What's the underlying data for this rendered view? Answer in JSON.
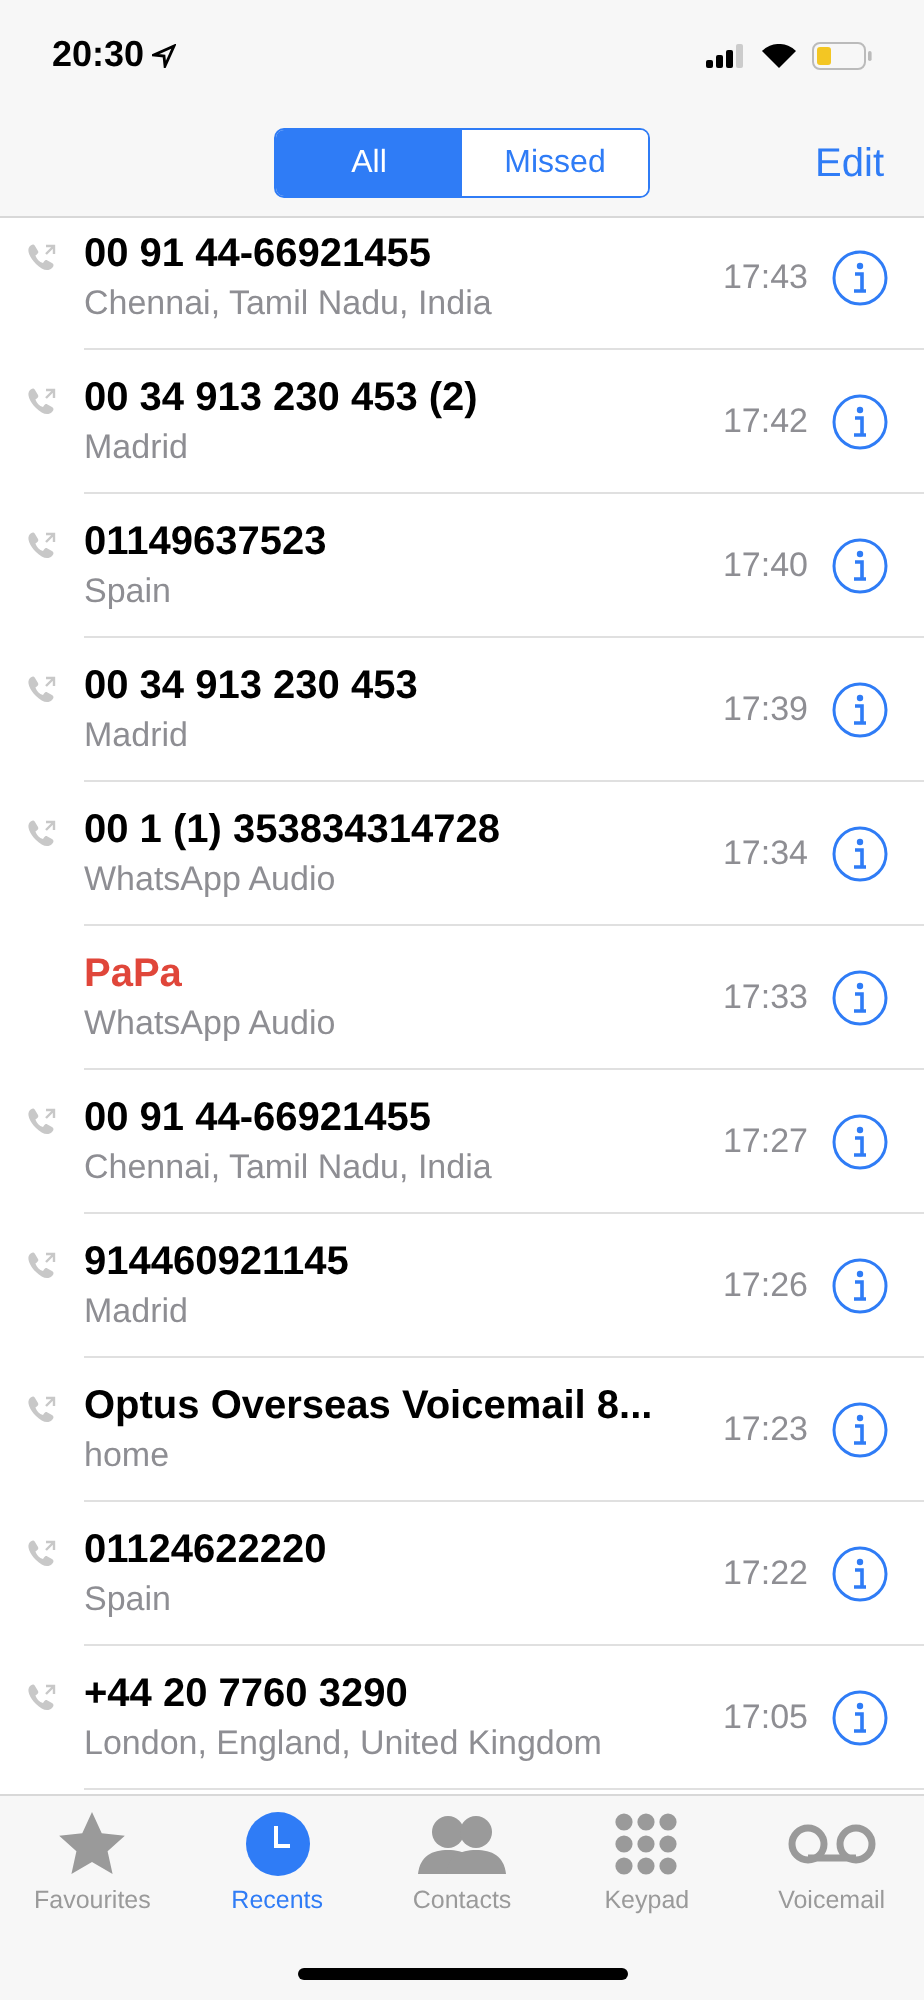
{
  "status_bar": {
    "time": "20:30"
  },
  "nav": {
    "segments": [
      {
        "label": "All",
        "selected": true
      },
      {
        "label": "Missed",
        "selected": false
      }
    ],
    "edit": "Edit"
  },
  "calls": [
    {
      "name": "00 91 44-66921455",
      "detail": "Chennai, Tamil Nadu, India",
      "time": "17:43",
      "missed": false
    },
    {
      "name": "00 34 913 230 453 (2)",
      "detail": "Madrid",
      "time": "17:42",
      "missed": false
    },
    {
      "name": "01149637523",
      "detail": "Spain",
      "time": "17:40",
      "missed": false
    },
    {
      "name": "00 34 913 230 453",
      "detail": "Madrid",
      "time": "17:39",
      "missed": false
    },
    {
      "name": "00 1 (1) 353834314728",
      "detail": "WhatsApp Audio",
      "time": "17:34",
      "missed": false
    },
    {
      "name": "PaPa",
      "detail": "WhatsApp Audio",
      "time": "17:33",
      "missed": true
    },
    {
      "name": "00 91 44-66921455",
      "detail": "Chennai, Tamil Nadu, India",
      "time": "17:27",
      "missed": false
    },
    {
      "name": "914460921145",
      "detail": "Madrid",
      "time": "17:26",
      "missed": false
    },
    {
      "name": "Optus Overseas Voicemail  8...",
      "detail": "home",
      "time": "17:23",
      "missed": false
    },
    {
      "name": "01124622220",
      "detail": "Spain",
      "time": "17:22",
      "missed": false
    },
    {
      "name": "+44 20 7760 3290",
      "detail": "London, England, United Kingdom",
      "time": "17:05",
      "missed": false
    }
  ],
  "tab_bar": [
    {
      "label": "Favourites",
      "kind": "star",
      "selected": false
    },
    {
      "label": "Recents",
      "kind": "clock",
      "selected": true
    },
    {
      "label": "Contacts",
      "kind": "people",
      "selected": false
    },
    {
      "label": "Keypad",
      "kind": "keypad",
      "selected": false
    },
    {
      "label": "Voicemail",
      "kind": "voicemail",
      "selected": false
    }
  ]
}
